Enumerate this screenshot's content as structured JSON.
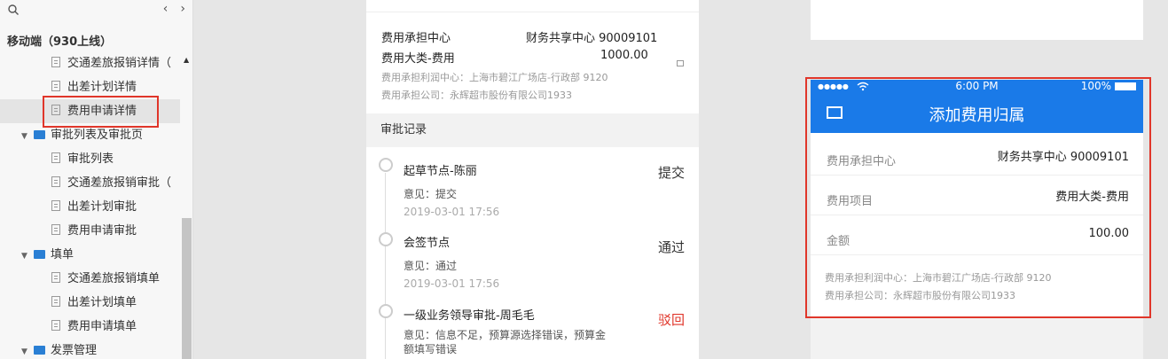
{
  "sidebar": {
    "arrows": [
      "‹",
      "›"
    ],
    "section_title": "移动端（930上线）",
    "items": [
      {
        "label": "交通差旅报销详情（",
        "kind": "doc"
      },
      {
        "label": "出差计划详情",
        "kind": "doc"
      },
      {
        "label": "费用申请详情",
        "kind": "doc",
        "selected": true
      },
      {
        "label": "审批列表及审批页",
        "kind": "folder"
      },
      {
        "label": "审批列表",
        "kind": "doc"
      },
      {
        "label": "交通差旅报销审批（",
        "kind": "doc"
      },
      {
        "label": "出差计划审批",
        "kind": "doc"
      },
      {
        "label": "费用申请审批",
        "kind": "doc"
      },
      {
        "label": "填单",
        "kind": "folder"
      },
      {
        "label": "交通差旅报销填单",
        "kind": "doc"
      },
      {
        "label": "出差计划填单",
        "kind": "doc"
      },
      {
        "label": "费用申请填单",
        "kind": "doc"
      },
      {
        "label": "发票管理",
        "kind": "folder"
      }
    ],
    "highlight_color": "#e0362a"
  },
  "detail": {
    "cost_center_label": "费用承担中心",
    "cost_center_value": "财务共享中心 90009101",
    "category_label": "费用大类-费用",
    "category_value": "1000.00",
    "profit_center": "费用承担利润中心：上海市碧江广场店-行政部 9120",
    "company": "费用承担公司：永辉超市股份有限公司1933",
    "records_header": "审批记录",
    "records": [
      {
        "title": "起草节点-陈丽",
        "opinion": "意见：提交",
        "time": "2019-03-01  17:56",
        "status": "提交",
        "rejected": false
      },
      {
        "title": "会签节点",
        "opinion": "意见：通过",
        "time": "2019-03-01  17:56",
        "status": "通过",
        "rejected": false
      },
      {
        "title": "一级业务领导审批-周毛毛",
        "opinion": "意见：信息不足，预算源选择错误，预算金",
        "opinion2": "额填写错误",
        "status": "驳回",
        "rejected": true
      }
    ]
  },
  "phone": {
    "status_bar": {
      "signal": "●●●●●",
      "time": "6:00 PM",
      "battery": "100%"
    },
    "title": "添加费用归属",
    "fields": [
      {
        "label": "费用承担中心",
        "value": "财务共享中心 90009101"
      },
      {
        "label": "费用项目",
        "value": "费用大类-费用"
      },
      {
        "label": "金额",
        "value": "100.00"
      }
    ],
    "notes": [
      "费用承担利润中心：上海市碧江广场店-行政部 9120",
      "费用承担公司：永辉超市股份有限公司1933"
    ],
    "accent_color": "#1a7ae8"
  }
}
